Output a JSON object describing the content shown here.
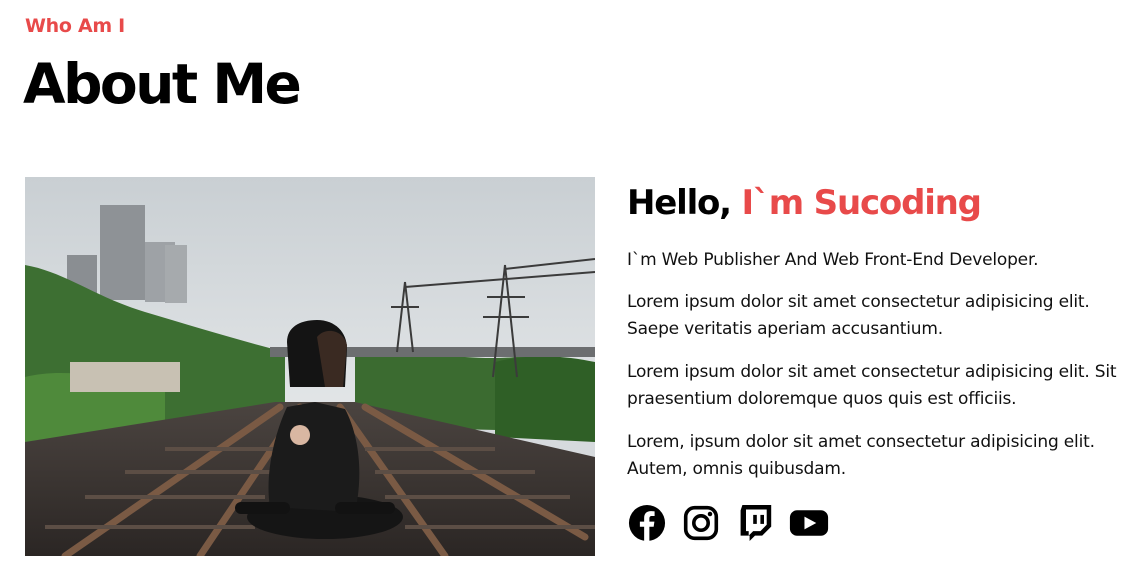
{
  "header": {
    "eyebrow": "Who Am I",
    "title": "About Me"
  },
  "intro": {
    "hello_prefix": "Hello, ",
    "hello_name": "I`m Sucoding",
    "paragraphs": [
      "I`m Web Publisher And Web Front-End Developer.",
      "Lorem ipsum dolor sit amet consectetur adipisicing elit. Saepe veritatis aperiam accusantium.",
      "Lorem ipsum dolor sit amet consectetur adipisicing elit. Sit praesentium doloremque quos quis est officiis.",
      "Lorem, ipsum dolor sit amet consectetur adipisicing elit. Autem, omnis quibusdam."
    ]
  },
  "photo": {
    "description_icon": "profile-photo"
  },
  "socials": [
    {
      "icon": "facebook-icon"
    },
    {
      "icon": "instagram-icon"
    },
    {
      "icon": "twitch-icon"
    },
    {
      "icon": "youtube-icon"
    }
  ],
  "colors": {
    "accent": "#e84a4a",
    "text": "#000000",
    "background": "#ffffff"
  }
}
